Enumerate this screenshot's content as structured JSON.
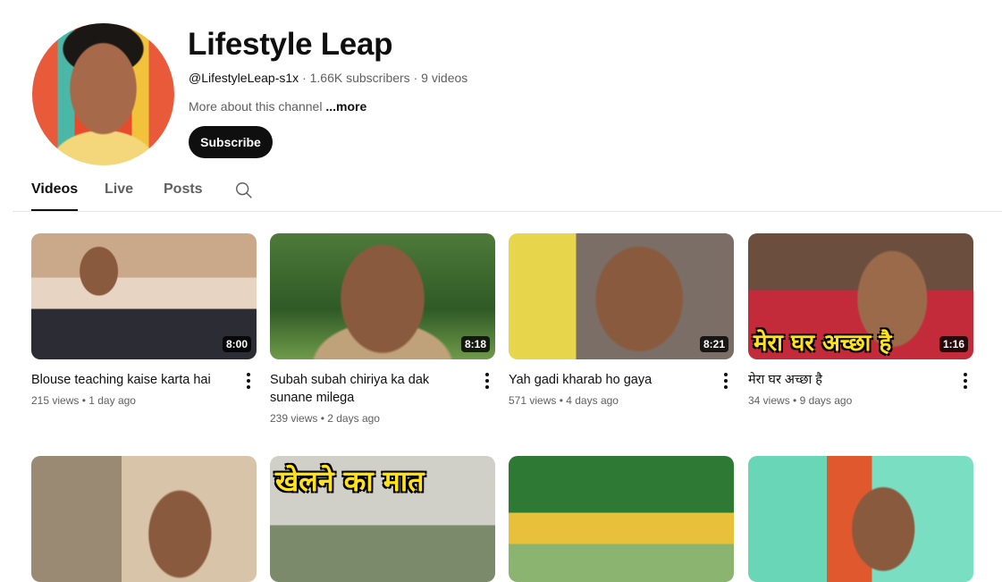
{
  "channel": {
    "name": "Lifestyle Leap",
    "handle": "@LifestyleLeap-s1x",
    "subscribers": "1.66K subscribers",
    "videos_count": "9 videos",
    "about": "More about this channel",
    "more": "...more",
    "subscribe_label": "Subscribe"
  },
  "tabs": [
    {
      "label": "Videos",
      "active": true
    },
    {
      "label": "Live",
      "active": false
    },
    {
      "label": "Posts",
      "active": false
    }
  ],
  "search_icon": "search-icon",
  "videos": [
    {
      "title": "Blouse teaching kaise karta hai",
      "views": "215 views",
      "ago": "1 day ago",
      "duration": "8:00"
    },
    {
      "title": "Subah subah chiriya ka dak sunane milega",
      "views": "239 views",
      "ago": "2 days ago",
      "duration": "8:18"
    },
    {
      "title": "Yah gadi kharab ho gaya",
      "views": "571 views",
      "ago": "4 days ago",
      "duration": "8:21"
    },
    {
      "title": "मेरा घर अच्छा है",
      "views": "34 views",
      "ago": "9 days ago",
      "duration": "1:16",
      "overlay": "मेरा घर अच्छा है"
    }
  ],
  "row2_overlays": {
    "second": "खेलने का मात"
  }
}
